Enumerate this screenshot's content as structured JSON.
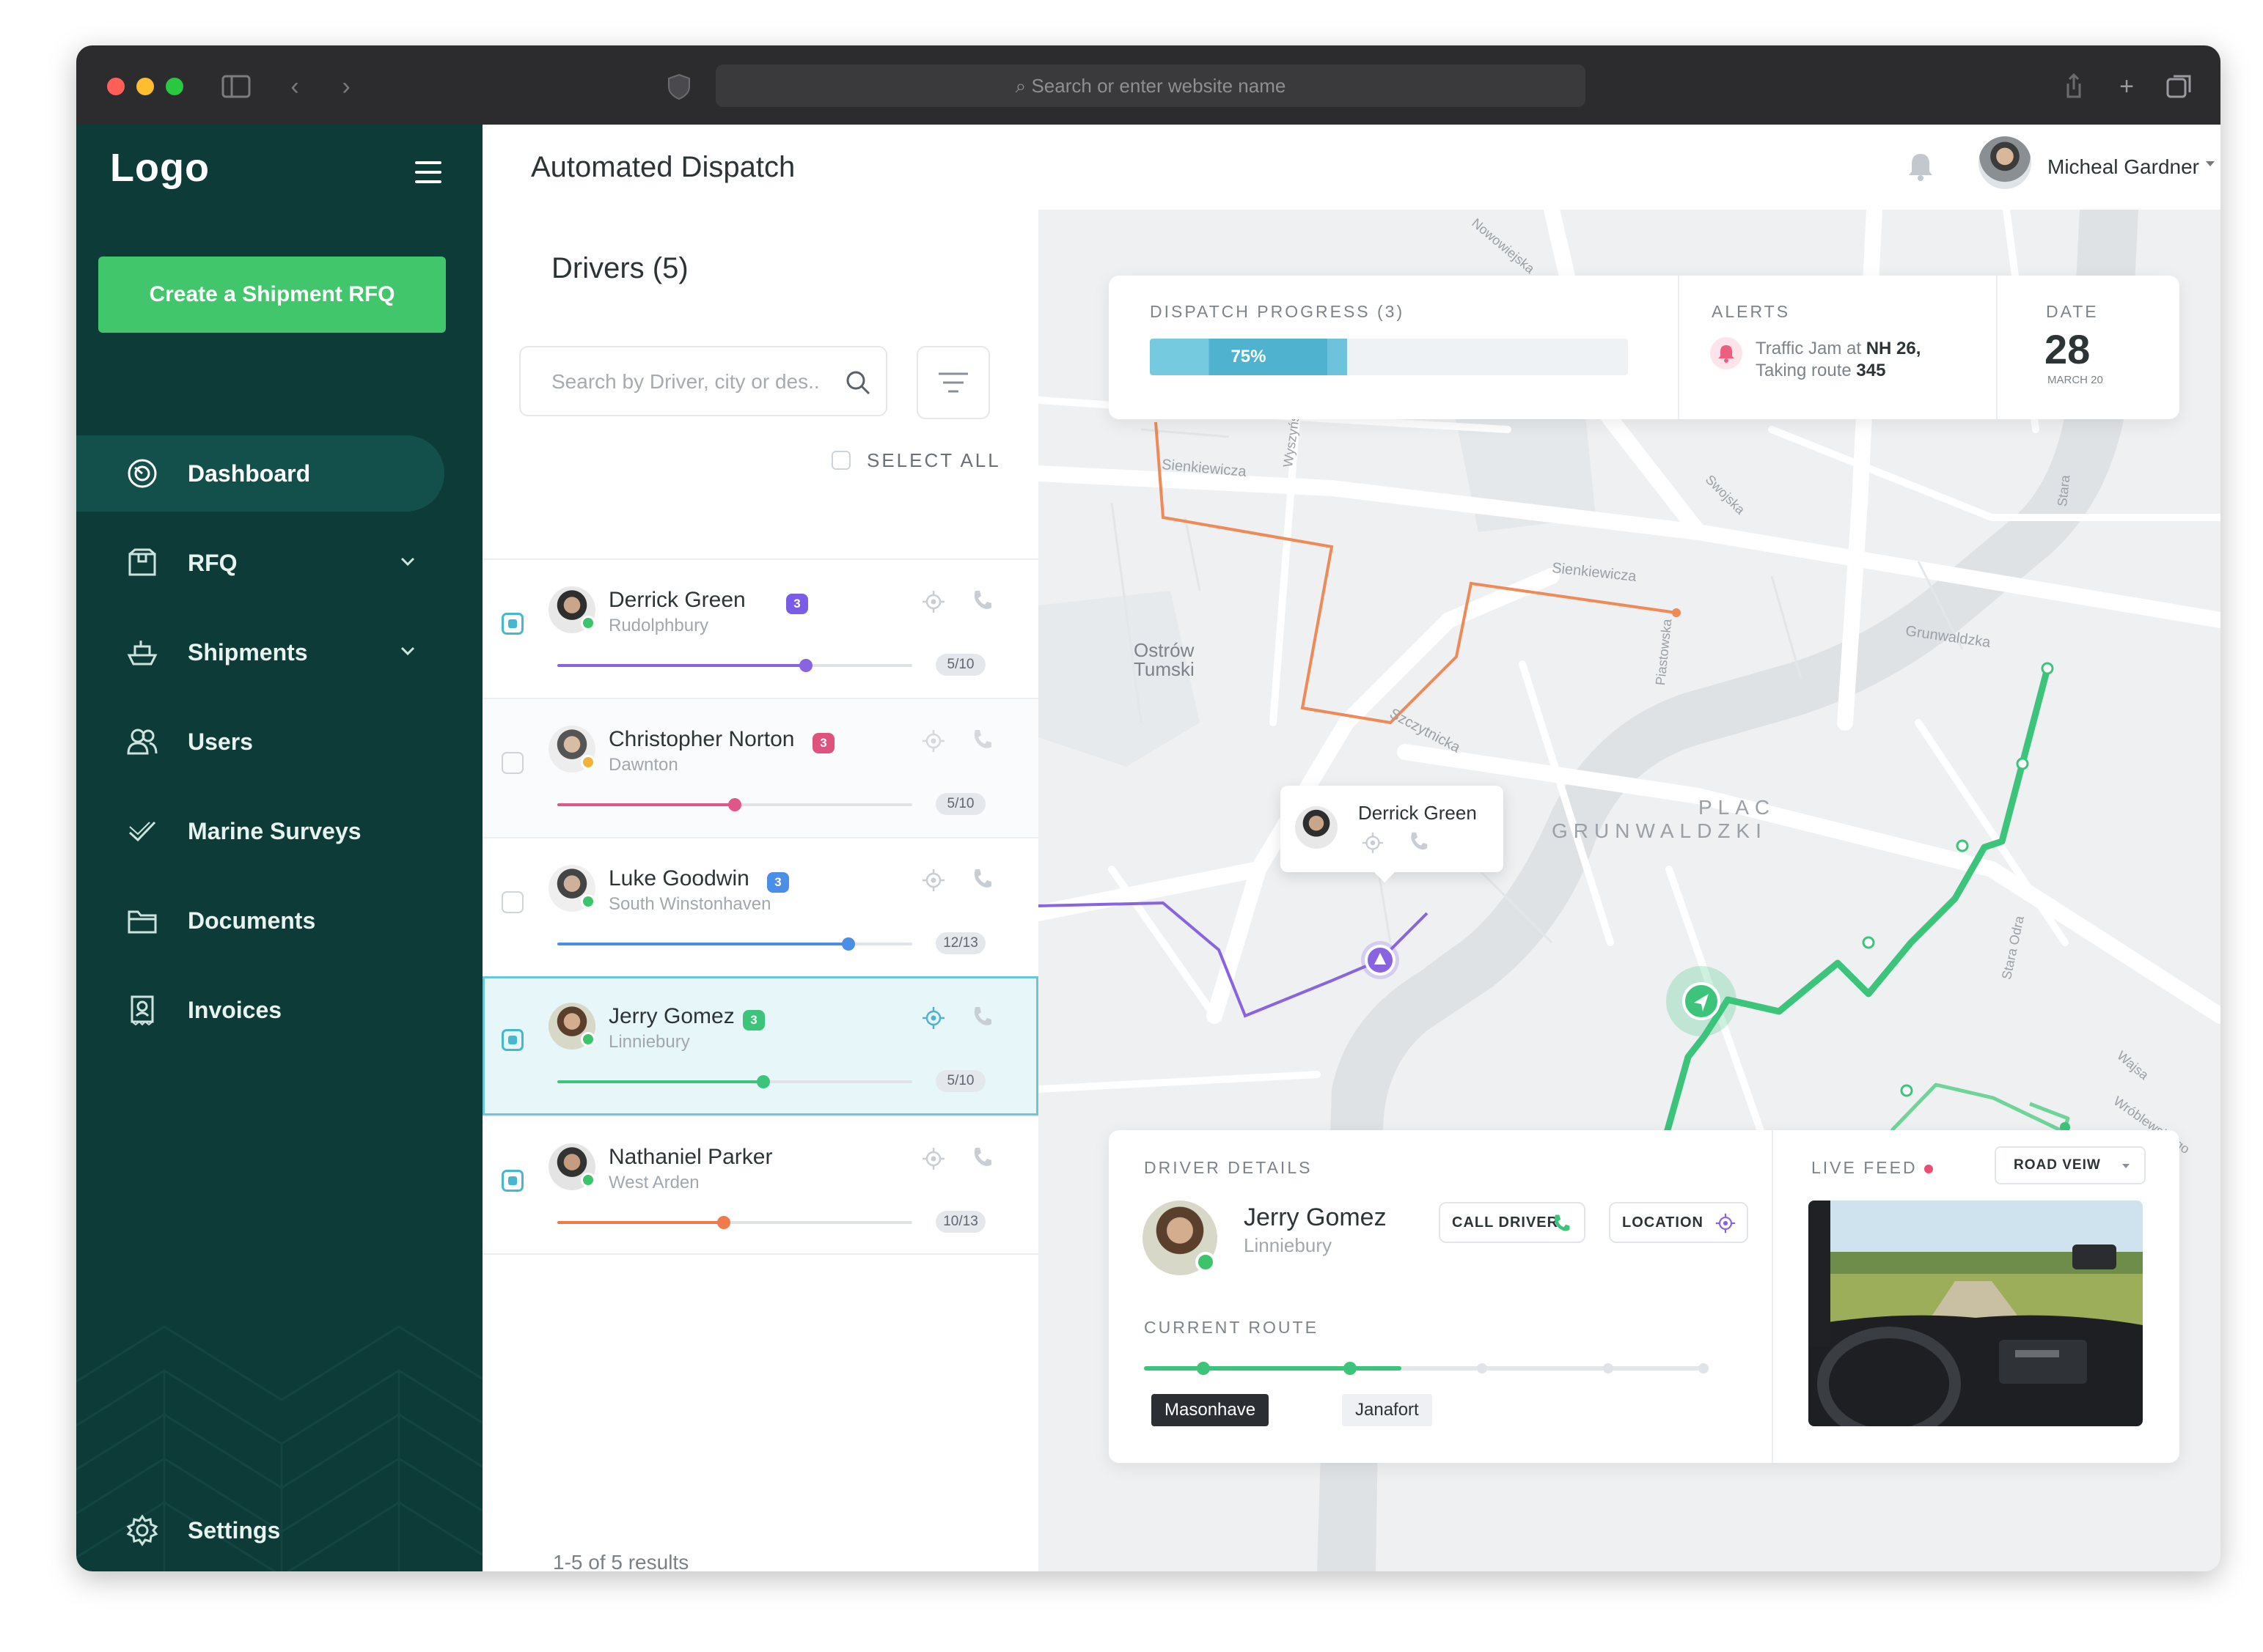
{
  "browser": {
    "url_placeholder": "Search or enter website name"
  },
  "sidebar": {
    "logo": "Logo",
    "cta": "Create a Shipment RFQ",
    "items": [
      {
        "label": "Dashboard",
        "icon": "dashboard-icon",
        "active": true
      },
      {
        "label": "RFQ",
        "icon": "box-icon",
        "expandable": true
      },
      {
        "label": "Shipments",
        "icon": "ship-icon",
        "expandable": true
      },
      {
        "label": "Users",
        "icon": "users-icon"
      },
      {
        "label": "Marine Surveys",
        "icon": "check-icon"
      },
      {
        "label": "Documents",
        "icon": "folder-icon"
      },
      {
        "label": "Invoices",
        "icon": "invoice-icon"
      }
    ],
    "settings": "Settings"
  },
  "header": {
    "title": "Automated Dispatch",
    "user_name": "Micheal Gardner"
  },
  "drivers": {
    "title": "Drivers (5)",
    "search_placeholder": "Search by Driver, city or des..",
    "select_all": "SELECT ALL",
    "list": [
      {
        "name": "Derrick Green",
        "city": "Rudolphbury",
        "badge": "3",
        "badge_color": "#7c5ce6",
        "count": "5/10",
        "progress": 0.7,
        "color": "#8a63e0",
        "checked": true
      },
      {
        "name": "Christopher Norton",
        "city": "Dawnton",
        "badge": "3",
        "badge_color": "#e0527e",
        "count": "5/10",
        "progress": 0.5,
        "color": "#e0568a",
        "checked": false
      },
      {
        "name": "Luke Goodwin",
        "city": "South Winstonhaven",
        "badge": "3",
        "badge_color": "#4b8ee8",
        "count": "12/13",
        "progress": 0.82,
        "color": "#4b8ee8",
        "checked": false
      },
      {
        "name": "Jerry Gomez",
        "city": "Linniebury",
        "badge": "3",
        "badge_color": "#3cc47a",
        "count": "5/10",
        "progress": 0.58,
        "color": "#3cc47a",
        "checked": true
      },
      {
        "name": "Nathaniel Parker",
        "city": "West Arden",
        "badge": "",
        "badge_color": "",
        "count": "10/13",
        "progress": 0.47,
        "color": "#ef7a4a",
        "checked": true
      }
    ],
    "results": "1-5 of 5 results"
  },
  "dispatch": {
    "progress_label": "DISPATCH PROGRESS (3)",
    "progress_value": 0.75,
    "progress_text": "75%",
    "alerts_label": "ALERTS",
    "alert_line1_prefix": "Traffic Jam at",
    "alert_line1_bold": "NH 26,",
    "alert_line2_prefix": "Taking route",
    "alert_line2_bold": "345",
    "date_label": "DATE",
    "date_day": "28",
    "date_month": "MARCH 20"
  },
  "map": {
    "labels": [
      "Sienkiewicza",
      "Sienkiewicza",
      "Ostrów Tumski",
      "Wyszyńskiego",
      "Piastowska",
      "Grunwaldzka",
      "Szczytnicka",
      "PLAC",
      "GRUNWALDZKI",
      "Stara Odra",
      "Wróblewskiego",
      "Nowowiejska",
      "Stara",
      "Wajsa",
      "Swojska"
    ],
    "popup_name": "Derrick Green"
  },
  "details": {
    "label": "DRIVER DETAILS",
    "name": "Jerry Gomez",
    "city": "Linniebury",
    "call_btn": "CALL DRIVER",
    "location_btn": "LOCATION",
    "route_label": "CURRENT ROUTE",
    "route_progress": 0.46,
    "stop_current": "Masonhave",
    "stop_next": "Janafort",
    "live_label": "LIVE FEED",
    "view_select": "ROAD VEIW"
  }
}
